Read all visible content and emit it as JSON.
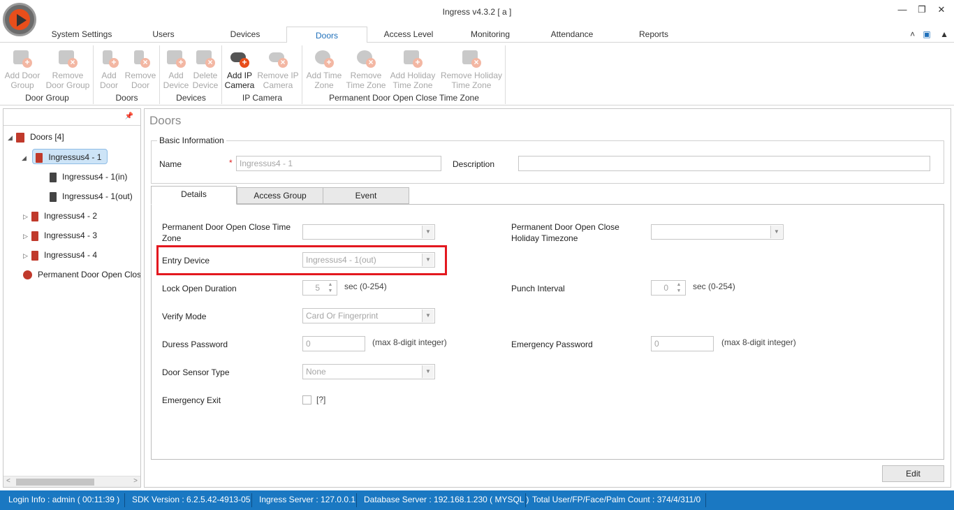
{
  "window": {
    "title": "Ingress v4.3.2 [ a ]",
    "minimize": "—",
    "restore": "❐",
    "close": "✕"
  },
  "tabs": [
    {
      "label": "System Settings"
    },
    {
      "label": "Users"
    },
    {
      "label": "Devices"
    },
    {
      "label": "Doors"
    },
    {
      "label": "Access Level"
    },
    {
      "label": "Monitoring"
    },
    {
      "label": "Attendance"
    },
    {
      "label": "Reports"
    }
  ],
  "ribbon_right": {
    "collapse": "˄",
    "office": "▣"
  },
  "ribbon": {
    "groups": [
      {
        "label": "Door Group",
        "buttons": [
          {
            "label1": "Add Door",
            "label2": "Group"
          },
          {
            "label1": "Remove",
            "label2": "Door Group"
          }
        ]
      },
      {
        "label": "Doors",
        "buttons": [
          {
            "label1": "Add",
            "label2": "Door"
          },
          {
            "label1": "Remove",
            "label2": "Door"
          }
        ]
      },
      {
        "label": "Devices",
        "buttons": [
          {
            "label1": "Add",
            "label2": "Device"
          },
          {
            "label1": "Delete",
            "label2": "Device"
          }
        ]
      },
      {
        "label": "IP Camera",
        "buttons": [
          {
            "label1": "Add IP",
            "label2": "Camera"
          },
          {
            "label1": "Remove IP",
            "label2": "Camera"
          }
        ]
      },
      {
        "label": "Permanent Door Open Close Time Zone",
        "buttons": [
          {
            "label1": "Add Time",
            "label2": "Zone"
          },
          {
            "label1": "Remove",
            "label2": "Time Zone"
          },
          {
            "label1": "Add Holiday",
            "label2": "Time Zone"
          },
          {
            "label1": "Remove Holiday",
            "label2": "Time Zone"
          }
        ]
      }
    ]
  },
  "tree": {
    "pin": "📌",
    "nodes": [
      {
        "label": "Doors [4]",
        "exp": "◢"
      },
      {
        "label": "Ingressus4 - 1",
        "exp": "◢"
      },
      {
        "label": "Ingressus4 - 1(in)"
      },
      {
        "label": "Ingressus4 - 1(out)"
      },
      {
        "label": "Ingressus4 - 2",
        "exp": "▷"
      },
      {
        "label": "Ingressus4 - 3",
        "exp": "▷"
      },
      {
        "label": "Ingressus4 - 4",
        "exp": "▷"
      },
      {
        "label": "Permanent Door Open Close"
      }
    ],
    "scroll_left": "<",
    "scroll_right": ">"
  },
  "main": {
    "title": "Doors",
    "basic_info": {
      "legend": "Basic Information",
      "name_label": "Name",
      "required": "*",
      "name_value": "Ingressus4 - 1",
      "description_label": "Description",
      "description_value": ""
    },
    "detail_tabs": [
      {
        "label": "Details"
      },
      {
        "label": "Access Group"
      },
      {
        "label": "Event"
      }
    ],
    "details": {
      "pdoc_tz_label1": "Permanent Door Open Close Time",
      "pdoc_tz_label2": "Zone",
      "pdoc_tz_value": "",
      "pdoc_holiday_label1": "Permanent Door Open Close",
      "pdoc_holiday_label2": "Holiday Timezone",
      "pdoc_holiday_value": "",
      "entry_device_label": "Entry Device",
      "entry_device_value": "Ingressus4 - 1(out)",
      "lock_open_label": "Lock Open Duration",
      "lock_open_value": "5",
      "lock_open_hint": "sec (0-254)",
      "punch_interval_label": "Punch Interval",
      "punch_interval_value": "0",
      "punch_interval_hint": "sec (0-254)",
      "verify_mode_label": "Verify Mode",
      "verify_mode_value": "Card Or Fingerprint",
      "duress_label": "Duress Password",
      "duress_value": "0",
      "duress_hint": "(max 8-digit integer)",
      "emergency_pw_label": "Emergency Password",
      "emergency_pw_value": "0",
      "emergency_pw_hint": "(max 8-digit integer)",
      "door_sensor_label": "Door Sensor Type",
      "door_sensor_value": "None",
      "emergency_exit_label": "Emergency Exit",
      "emergency_exit_help": "[?]"
    },
    "edit_label": "Edit"
  },
  "statusbar": {
    "login": "Login Info : admin ( 00:11:39 )",
    "sdk": "SDK Version : 6.2.5.42-4913-05",
    "server": "Ingress Server : 127.0.0.1",
    "database": "Database Server : 192.168.1.230 ( MYSQL )",
    "counts": "Total User/FP/Face/Palm Count : 374/4/311/0"
  },
  "colors": {
    "accent": "#1e6fba",
    "statusbar": "#1a78c2",
    "highlight": "#e3181f",
    "logo": "#e84e1b"
  }
}
